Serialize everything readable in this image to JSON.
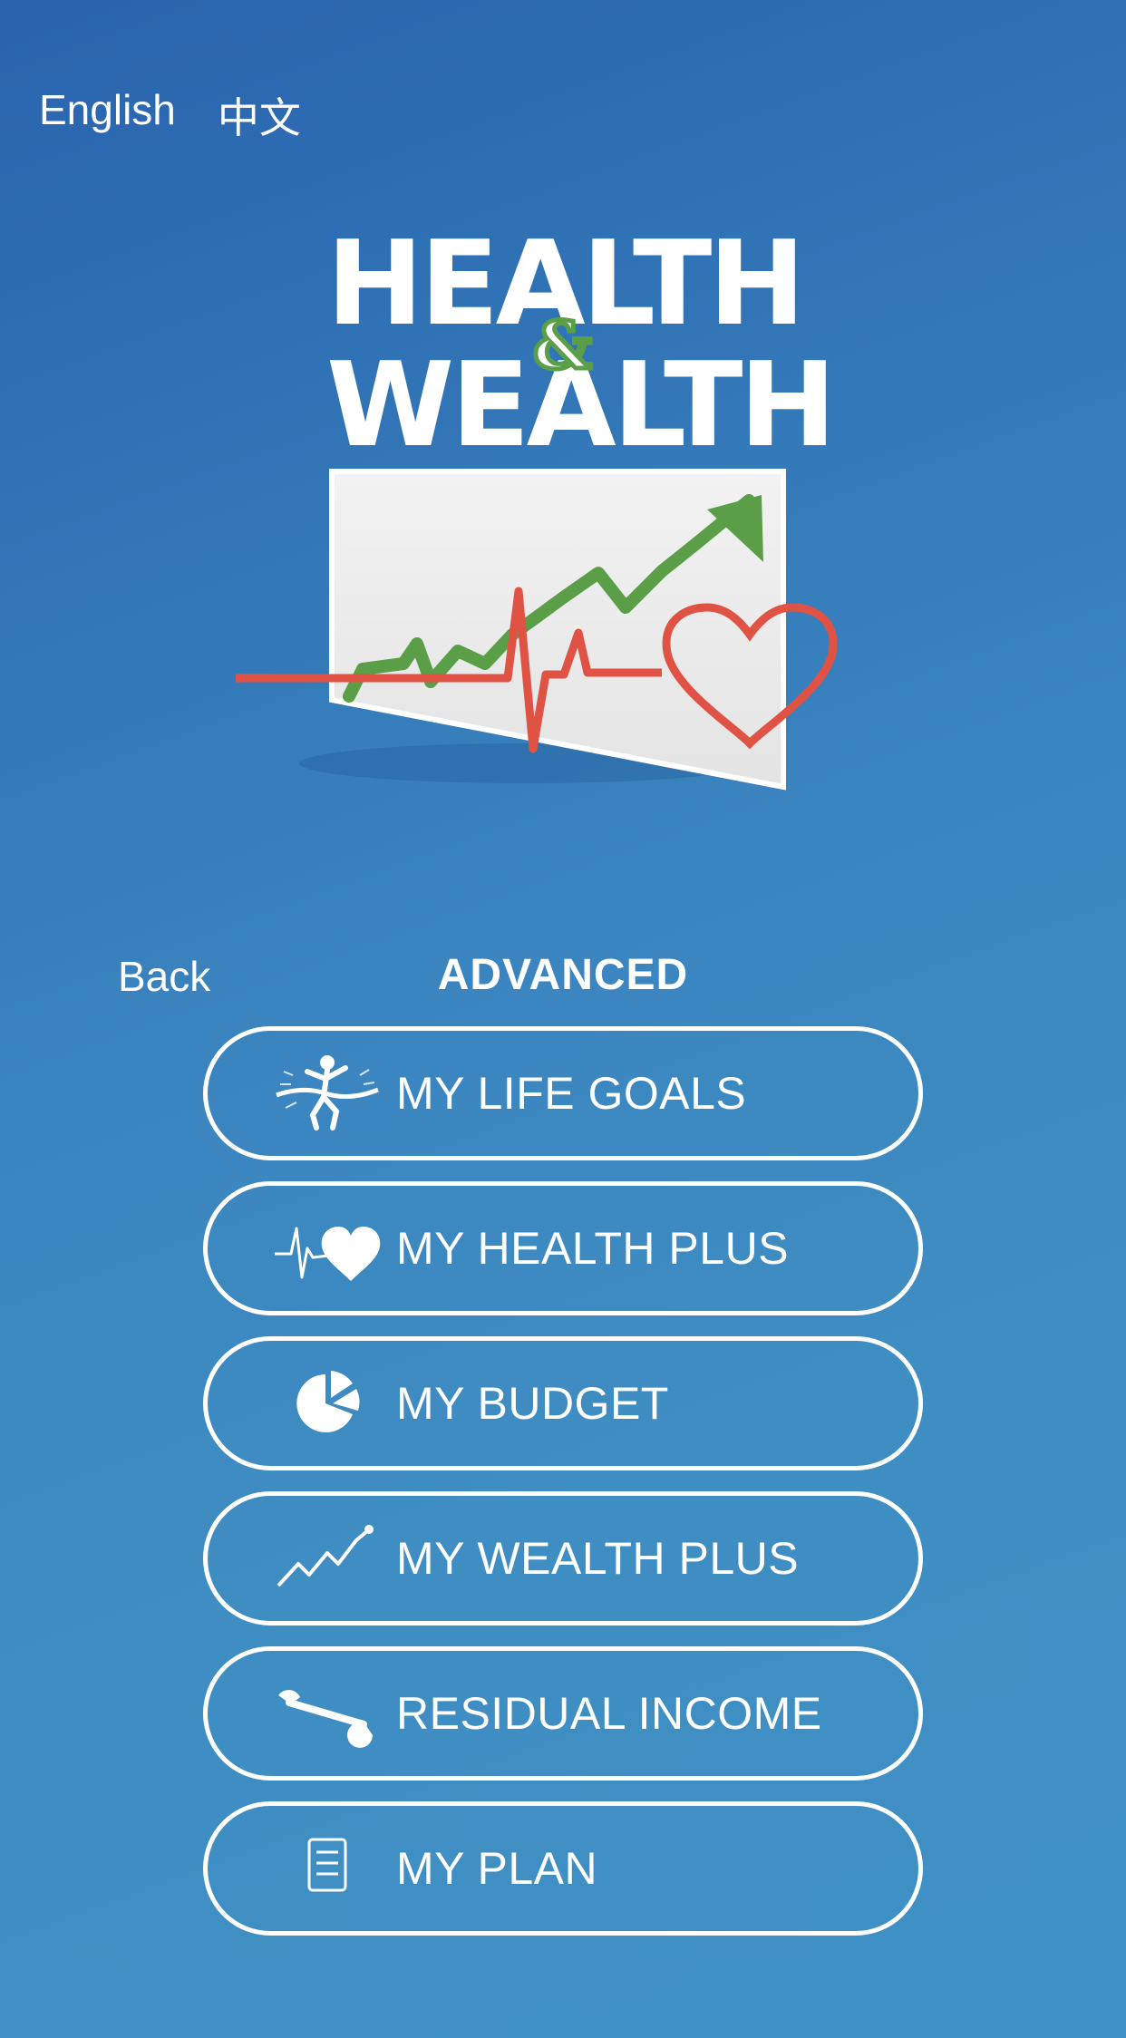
{
  "languages": {
    "english": "English",
    "chinese": "中文"
  },
  "logo": {
    "line1": "HEALTH",
    "amp": "&",
    "line2": "WEALTH"
  },
  "nav": {
    "back": "Back",
    "title": "ADVANCED"
  },
  "menu": [
    {
      "label": "MY LIFE GOALS",
      "icon": "runner-finish-line-icon"
    },
    {
      "label": "MY HEALTH PLUS",
      "icon": "heartbeat-icon"
    },
    {
      "label": "MY BUDGET",
      "icon": "pie-chart-icon"
    },
    {
      "label": "MY WEALTH PLUS",
      "icon": "trend-line-icon"
    },
    {
      "label": "RESIDUAL INCOME",
      "icon": "wrench-icon"
    },
    {
      "label": "MY PLAN",
      "icon": "document-icon"
    }
  ],
  "colors": {
    "accent_green": "#5a9f48",
    "heart_red": "#e05244",
    "background": "#3a84bf"
  }
}
